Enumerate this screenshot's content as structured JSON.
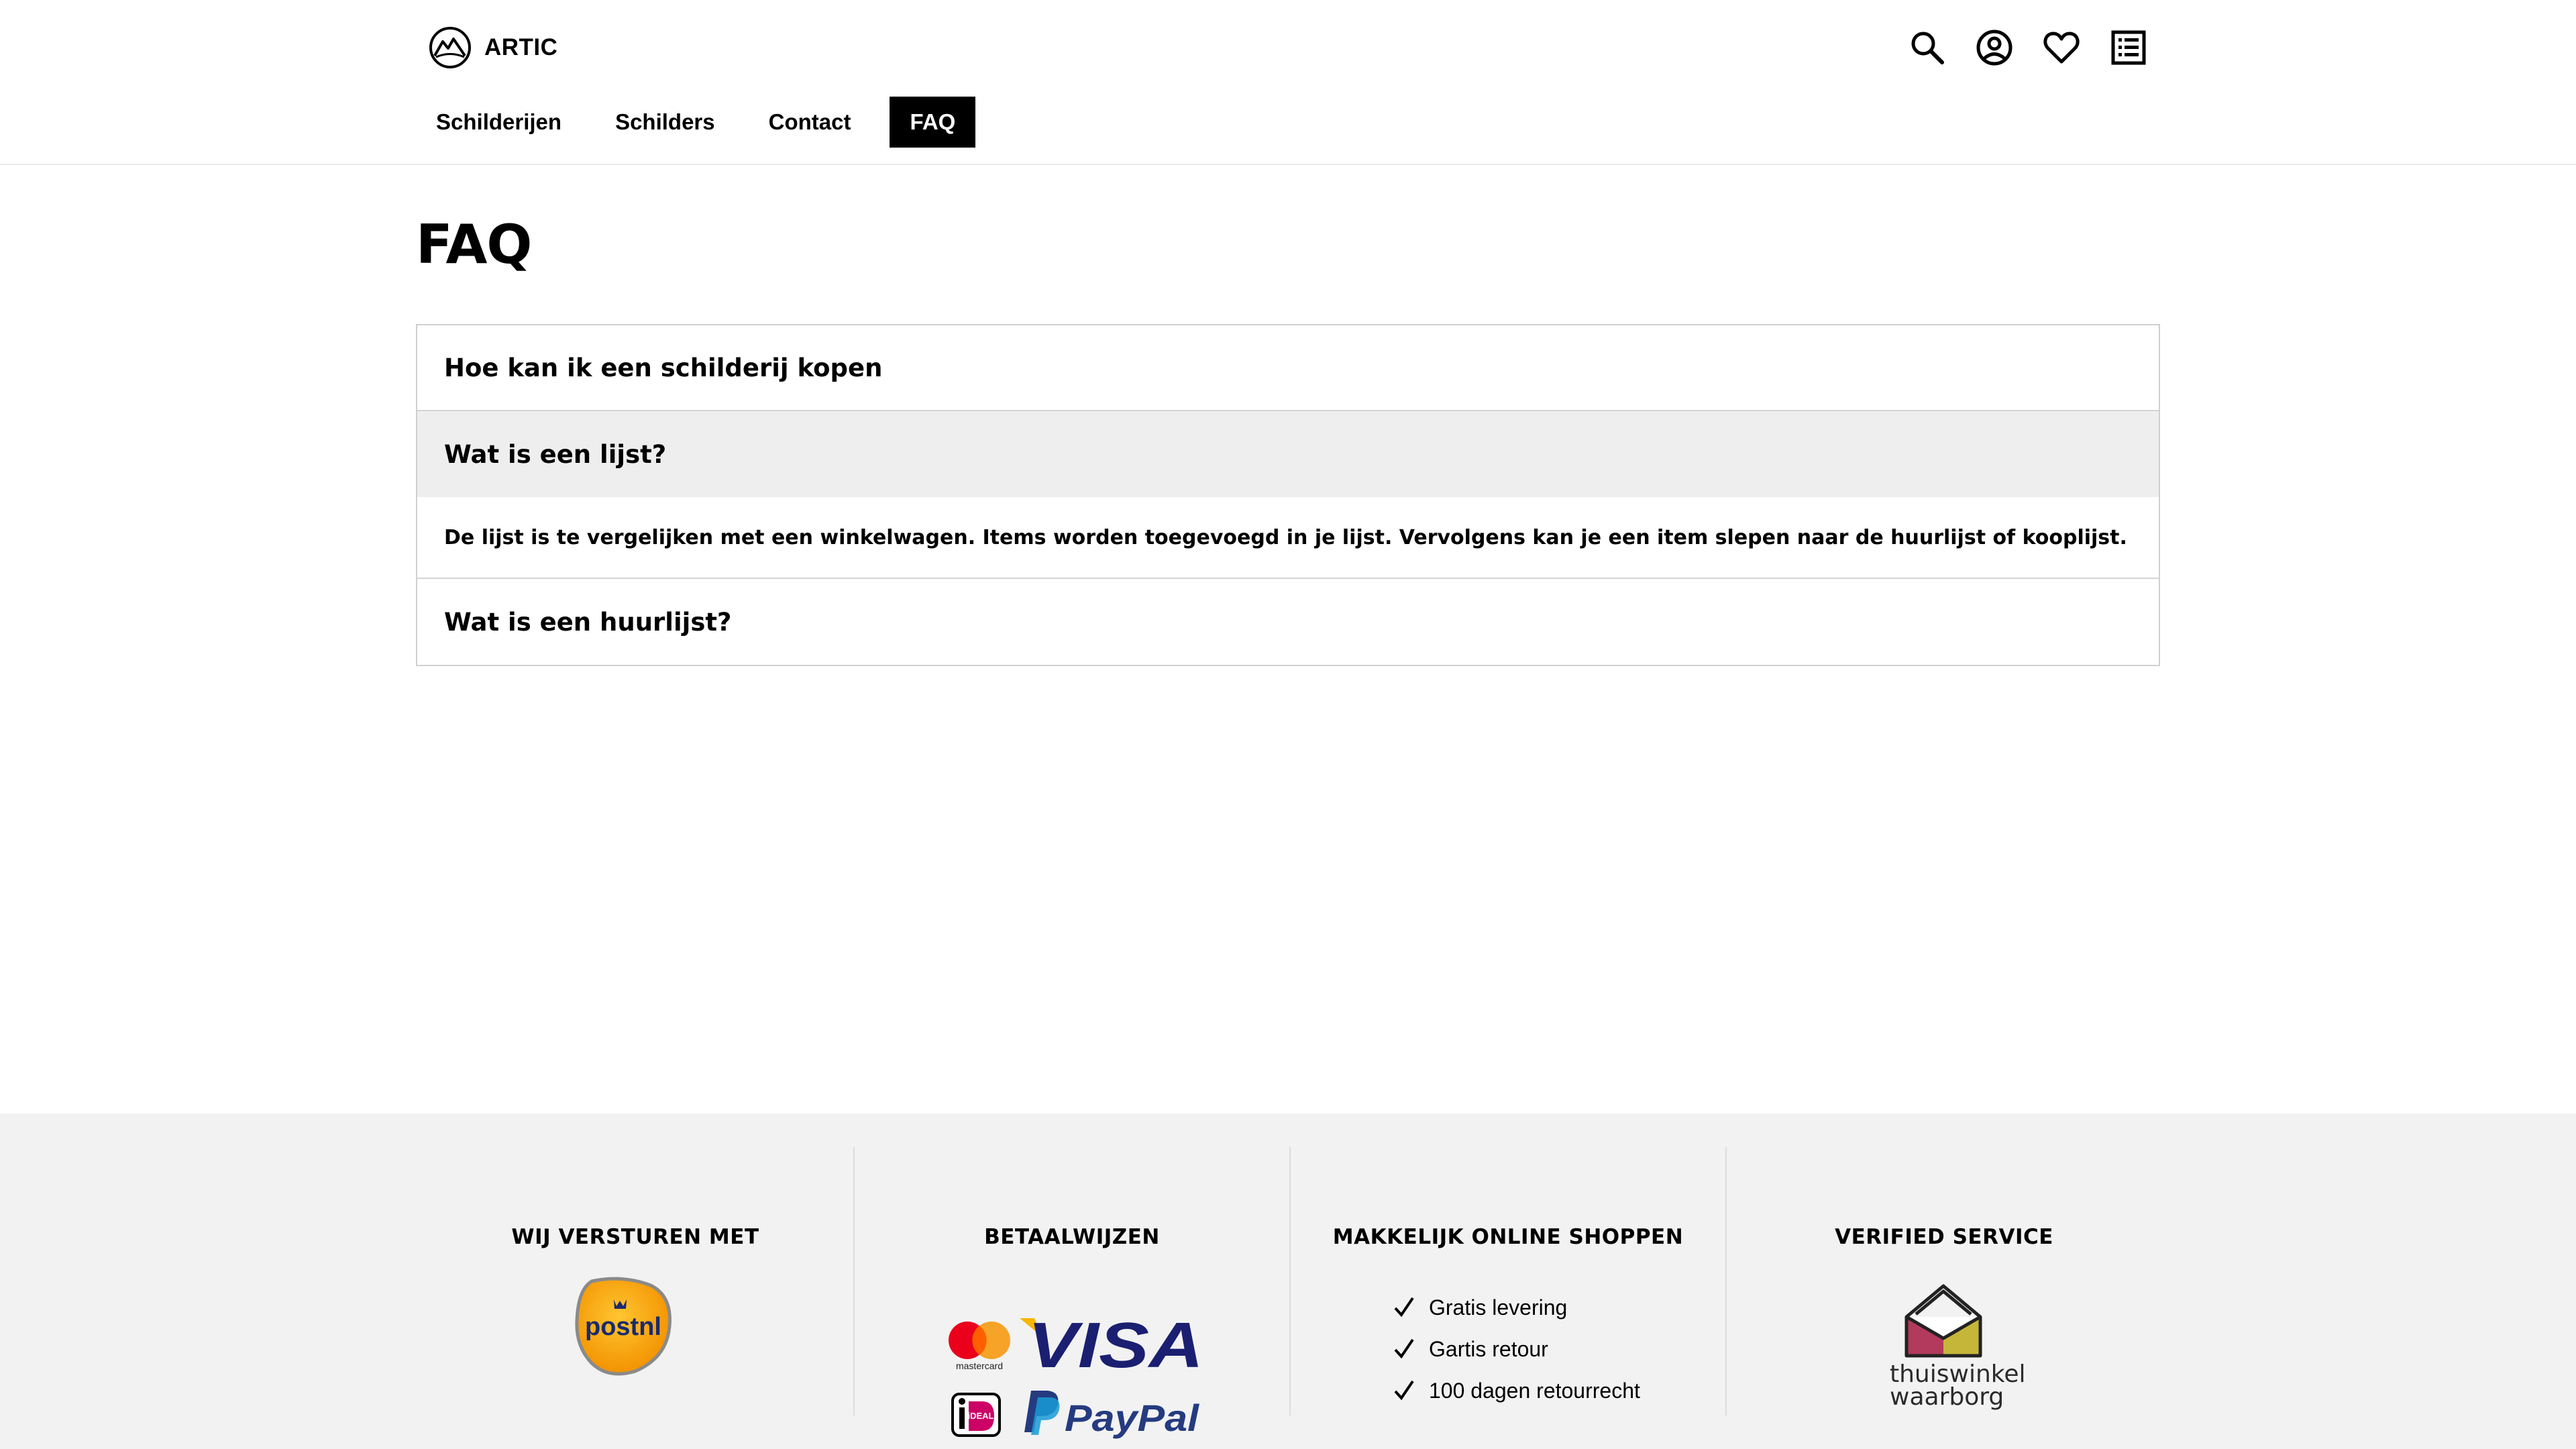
{
  "header": {
    "brand": "ARTIC",
    "icons": [
      "search-icon",
      "account-icon",
      "heart-icon",
      "list-icon"
    ],
    "nav": [
      {
        "label": "Schilderijen",
        "active": false
      },
      {
        "label": "Schilders",
        "active": false
      },
      {
        "label": "Contact",
        "active": false
      },
      {
        "label": "FAQ",
        "active": true
      }
    ]
  },
  "main": {
    "title": "FAQ",
    "faq": [
      {
        "question": "Hoe kan ik een schilderij kopen",
        "open": false
      },
      {
        "question": "Wat is een lijst?",
        "open": true,
        "answer": "De lijst is te vergelijken met een winkelwagen. Items worden toegevoegd in je lijst. Vervolgens kan je een item slepen naar de huurlijst of kooplijst."
      },
      {
        "question": "Wat is een huurlijst?",
        "open": false
      }
    ]
  },
  "footer": {
    "shipping": {
      "title": "WIJ VERSTUREN MET",
      "logo_text": "postnl"
    },
    "payment": {
      "title": "BETAALWIJZEN",
      "methods": [
        "mastercard",
        "VISA",
        "iDEAL",
        "PayPal"
      ]
    },
    "shopping": {
      "title": "MAKKELIJK ONLINE SHOPPEN",
      "items": [
        "Gratis levering",
        "Gartis retour",
        "100 dagen retourrecht"
      ]
    },
    "verified": {
      "title": "VERIFIED SERVICE",
      "logo_line1": "thuiswinkel",
      "logo_line2": "waarborg"
    }
  },
  "colors": {
    "accent": "#000000",
    "footer_bg": "#f2f2f2",
    "open_question_bg": "#eeeeee",
    "postnl_orange": "#f7a600",
    "visa_blue": "#1a1f71",
    "paypal_blue": "#253b80",
    "ideal_pink": "#cc0066"
  }
}
